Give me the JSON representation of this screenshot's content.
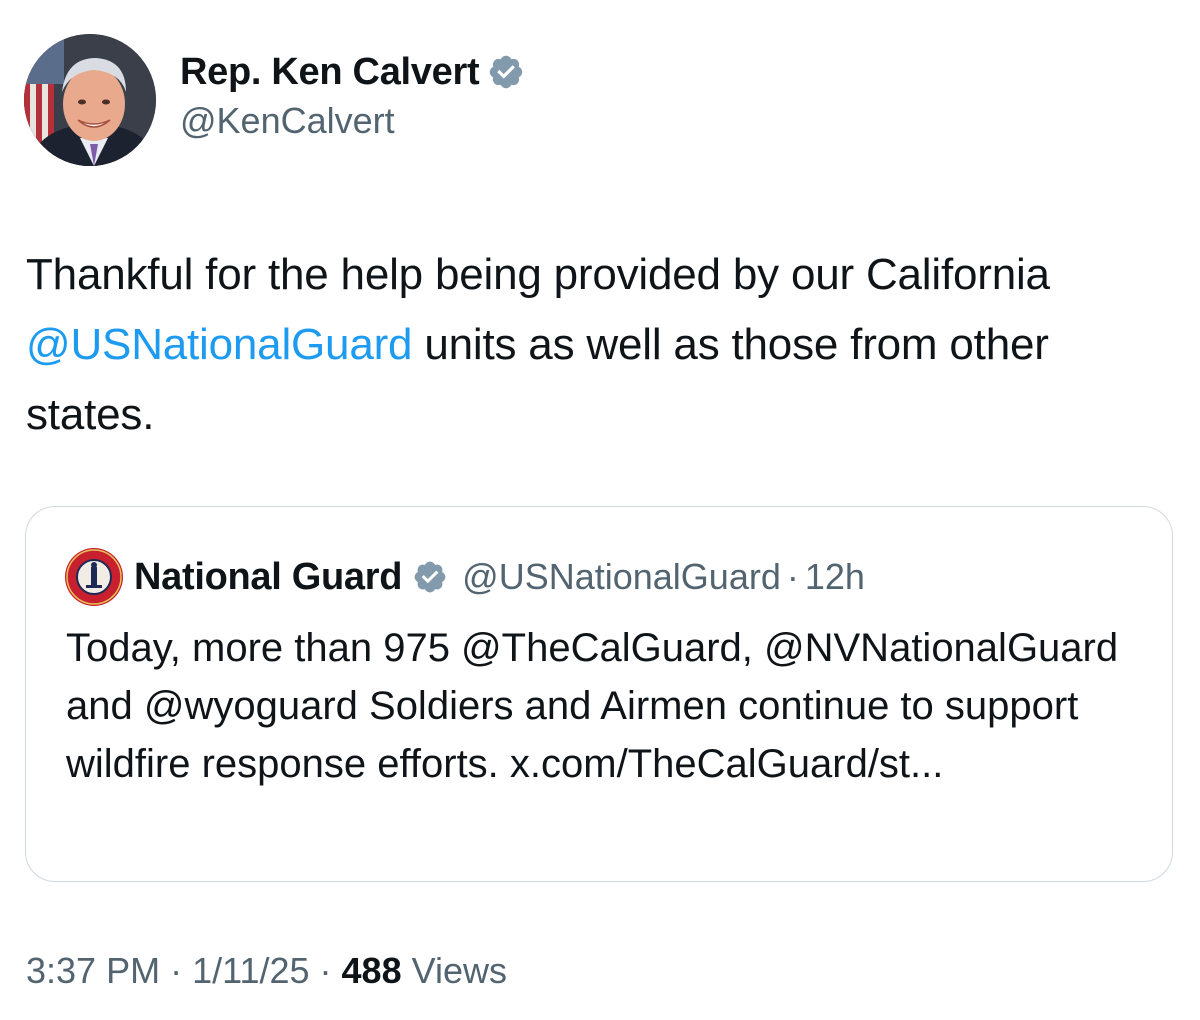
{
  "author": {
    "display_name": "Rep. Ken Calvert",
    "handle": "@KenCalvert",
    "verified_icon": "verified-badge-icon",
    "avatar": "profile-photo"
  },
  "tweet": {
    "text_before": "Thankful for the help being provided by our California ",
    "mention": "@USNationalGuard",
    "text_after": " units as well as those from other states."
  },
  "quote": {
    "display_name": "National Guard",
    "handle": "@USNationalGuard",
    "separator": "·",
    "time": "12h",
    "body": "Today, more than 975 @TheCalGuard, @NVNationalGuard and @wyoguard Soldiers and Airmen continue to support wildfire response efforts. x.com/TheCalGuard/st...",
    "logo_icon": "national-guard-seal-icon"
  },
  "meta": {
    "time": "3:37 PM",
    "separator": "·",
    "date": "1/11/25",
    "views_count": "488",
    "views_label": "Views"
  },
  "colors": {
    "accent": "#1d9bf0",
    "secondary_text": "#536471",
    "primary_text": "#0f1419",
    "border": "#cfd9de"
  }
}
